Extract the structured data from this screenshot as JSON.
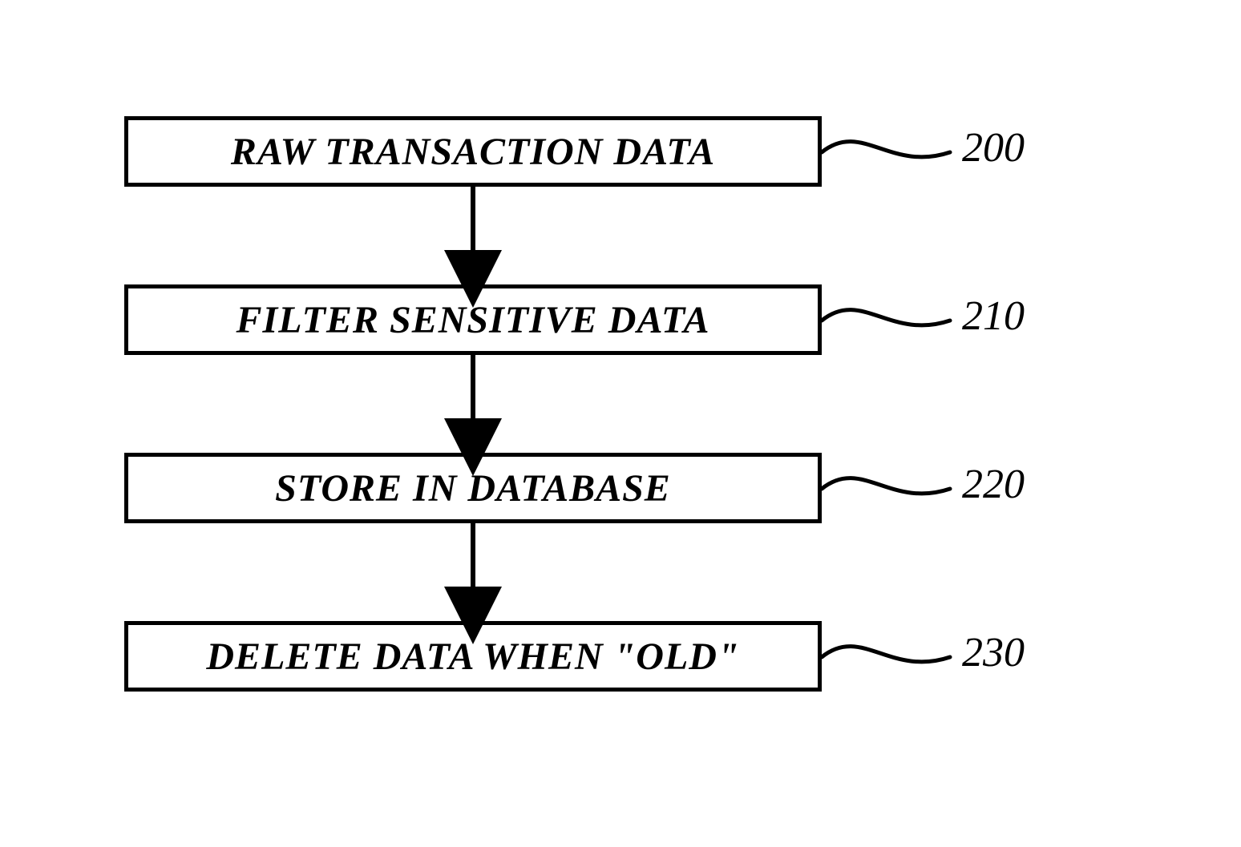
{
  "diagram": {
    "steps": [
      {
        "label": "RAW TRANSACTION DATA",
        "ref": "200"
      },
      {
        "label": "FILTER SENSITIVE DATA",
        "ref": "210"
      },
      {
        "label": "STORE IN DATABASE",
        "ref": "220"
      },
      {
        "label": "DELETE DATA WHEN \"OLD\"",
        "ref": "230"
      }
    ]
  }
}
